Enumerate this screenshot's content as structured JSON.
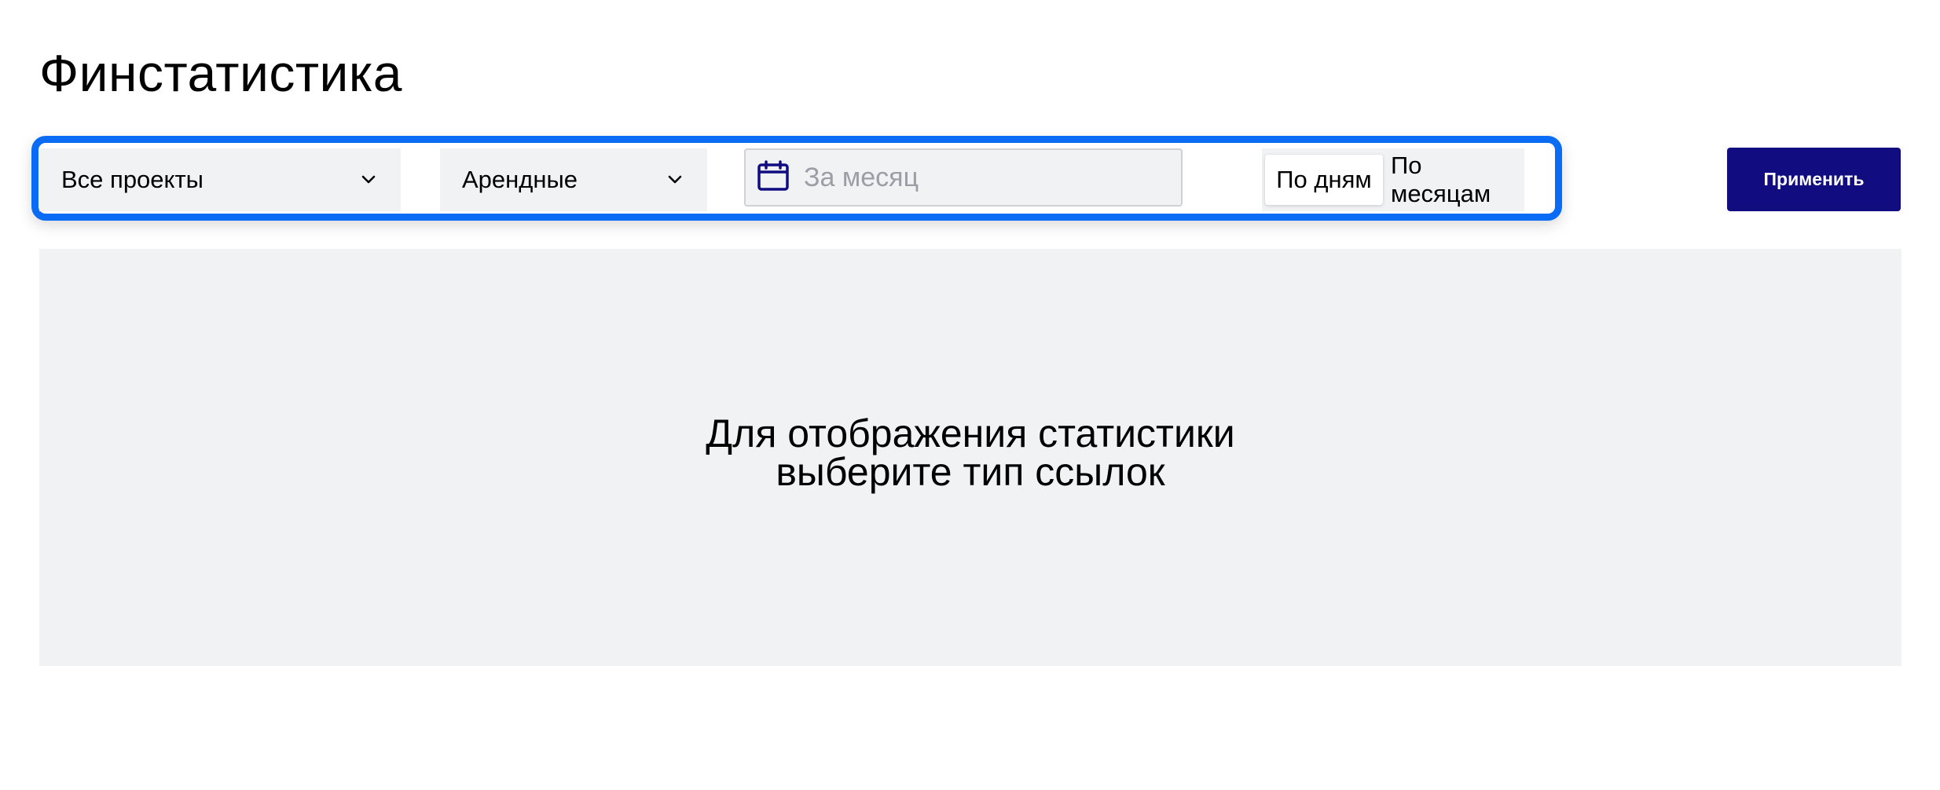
{
  "page": {
    "title": "Финстатистика"
  },
  "filters": {
    "project_select": {
      "value": "Все проекты",
      "icon": "chevron-down-icon"
    },
    "type_select": {
      "value": "Арендные",
      "icon": "chevron-down-icon"
    },
    "date_range": {
      "placeholder": "За месяц",
      "value": "",
      "icon": "calendar-icon"
    },
    "granularity": {
      "options": [
        "По дням",
        "По месяцам"
      ],
      "selected": "По дням"
    }
  },
  "actions": {
    "apply_label": "Применить"
  },
  "stats": {
    "empty_line1": "Для отображения статистики",
    "empty_line2": "выберите тип ссылок"
  },
  "colors": {
    "accent": "#110c80",
    "highlight": "#0a6cf5",
    "panel_bg": "#f1f2f4",
    "placeholder": "#9b9ea5"
  }
}
